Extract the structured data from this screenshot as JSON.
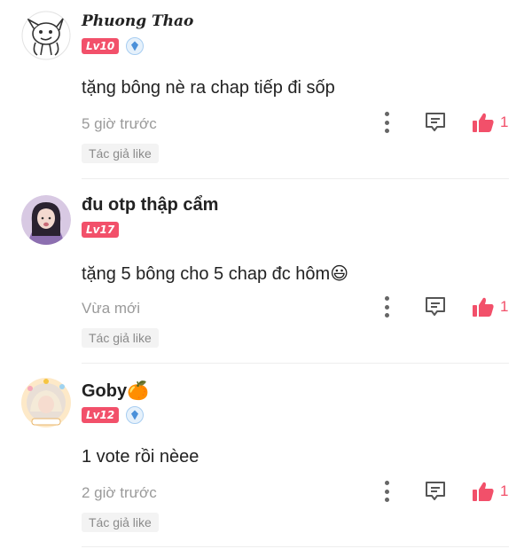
{
  "comments": [
    {
      "username": "Phuong Thao",
      "level": "Lv10",
      "has_vip_badge": true,
      "text": "tặng bông nè ra chap tiếp đi sốp",
      "time": "5 giờ trước",
      "likes": "1",
      "author_like": "Tác giả like",
      "avatar_icon": "cartoon-character-avatar"
    },
    {
      "username": "đu otp thập cẩm",
      "level": "Lv17",
      "has_vip_badge": false,
      "text": "tặng 5 bông cho 5 chap đc hôm😃",
      "time": "Vừa mới",
      "likes": "1",
      "author_like": "Tác giả like",
      "avatar_icon": "girl-photo-avatar"
    },
    {
      "username": "Goby🍊",
      "level": "Lv12",
      "has_vip_badge": true,
      "text": "1 vote rồi nèee",
      "time": "2 giờ trước",
      "likes": "1",
      "author_like": "Tác giả like",
      "avatar_icon": "framed-photo-avatar"
    }
  ],
  "colors": {
    "accent": "#f2506a",
    "muted_text": "#9a9a9a",
    "vip_badge": "#4a90d9"
  },
  "icons": {
    "more": "more-vertical-icon",
    "reply": "reply-comment-icon",
    "like": "thumbs-up-icon",
    "vip": "vip-diamond-icon"
  }
}
